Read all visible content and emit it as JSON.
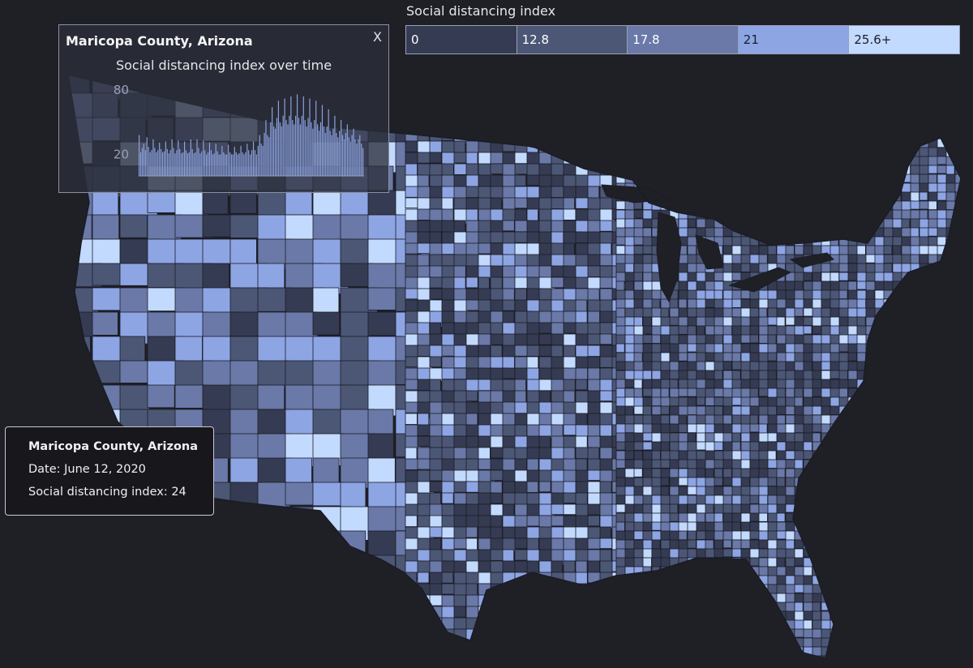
{
  "legend": {
    "title": "Social distancing index",
    "bins": [
      {
        "label": "0",
        "color": "#353b52"
      },
      {
        "label": "12.8",
        "color": "#4c5776"
      },
      {
        "label": "17.8",
        "color": "#6a79a8"
      },
      {
        "label": "21",
        "color": "#8ea5e4"
      },
      {
        "label": "25.6+",
        "color": "#c3daff"
      }
    ]
  },
  "trend_panel": {
    "title": "Maricopa County, Arizona",
    "close_label": "X",
    "subtitle": "Social distancing index over time"
  },
  "chart_data": {
    "type": "bar",
    "title": "Social distancing index over time",
    "xlabel": "",
    "ylabel": "",
    "yticks": [
      20,
      80
    ],
    "ylim": [
      0,
      80
    ],
    "values": [
      38,
      22,
      26,
      30,
      24,
      36,
      27,
      22,
      24,
      34,
      26,
      22,
      24,
      31,
      25,
      22,
      23,
      32,
      25,
      21,
      24,
      34,
      26,
      21,
      24,
      33,
      25,
      21,
      22,
      32,
      24,
      21,
      22,
      34,
      25,
      21,
      22,
      34,
      26,
      21,
      23,
      33,
      24,
      20,
      22,
      31,
      24,
      20,
      21,
      30,
      23,
      20,
      20,
      28,
      22,
      20,
      20,
      29,
      22,
      20,
      20,
      27,
      22,
      20,
      21,
      28,
      22,
      20,
      22,
      30,
      24,
      20,
      24,
      32,
      24,
      20,
      28,
      38,
      30,
      28,
      40,
      52,
      38,
      36,
      50,
      64,
      46,
      44,
      54,
      70,
      50,
      46,
      56,
      72,
      52,
      48,
      56,
      74,
      52,
      48,
      56,
      76,
      54,
      48,
      56,
      74,
      52,
      46,
      54,
      72,
      50,
      44,
      52,
      70,
      48,
      42,
      50,
      66,
      46,
      40,
      46,
      62,
      42,
      38,
      44,
      56,
      40,
      36,
      42,
      52,
      38,
      34,
      40,
      48,
      36,
      32,
      38,
      44,
      34,
      30,
      34,
      38,
      30,
      26
    ],
    "color": "#8ea5e4"
  },
  "tooltip": {
    "title": "Maricopa County, Arizona",
    "date": "Date: June 12, 2020",
    "value": "Social distancing index: 24"
  },
  "map": {
    "background": "#1f1f26",
    "border_color": "#1a1c26"
  }
}
